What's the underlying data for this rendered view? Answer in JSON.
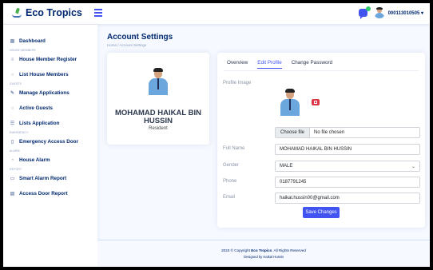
{
  "app": {
    "name": "Eco Tropics",
    "user_id": "000113010505",
    "accent": "#4154f1"
  },
  "sidebar": {
    "items": [
      {
        "label": "Dashboard",
        "icon": "grid-icon"
      },
      {
        "heading": "HOUSE MEMBERS"
      },
      {
        "label": "House Member Register",
        "icon": "menu-icon"
      },
      {
        "label": "List House Members",
        "icon": "circle-icon"
      },
      {
        "heading": "GUESTS"
      },
      {
        "label": "Manage Applications",
        "icon": "pencil-icon"
      },
      {
        "label": "Active Guests",
        "icon": "circle-icon"
      },
      {
        "label": "Lists Application",
        "icon": "list-icon"
      },
      {
        "heading": "EMERGENCY"
      },
      {
        "label": "Emergency Access Door",
        "icon": "door-icon"
      },
      {
        "heading": "ALARM"
      },
      {
        "label": "House Alarm",
        "icon": "alarm-icon"
      },
      {
        "heading": "REPORT"
      },
      {
        "label": "Smart Alarm Report",
        "icon": "report-icon"
      },
      {
        "label": "Access Door Report",
        "icon": "document-icon"
      }
    ]
  },
  "page": {
    "title": "Account Settings",
    "breadcrumb": "Home  /  Account Settings"
  },
  "profile": {
    "name_line1": "MOHAMAD HAIKAL BIN",
    "name_line2": "HUSSIN",
    "role": "Resident"
  },
  "tabs": [
    "Overview",
    "Edit Profile",
    "Change Password"
  ],
  "form": {
    "profile_image_label": "Profile Image",
    "choose_file_label": "Choose file",
    "no_file_text": "No file chosen",
    "full_name_label": "Full Name",
    "full_name_value": "MOHAMAD HAIKAL BIN HUSSIN",
    "gender_label": "Gender",
    "gender_value": "MALE",
    "phone_label": "Phone",
    "phone_value": "0187791245",
    "email_label": "Email",
    "email_value": "haikal.hussin00@gmail.com",
    "save_label": "Save Changes"
  },
  "footer": {
    "copyright_prefix": "2023 © Copyright ",
    "copyright_brand": "Eco Tropics",
    "copyright_suffix": ". All Rights Reserved",
    "designed_by": "Designed by Haikal Hussin"
  }
}
